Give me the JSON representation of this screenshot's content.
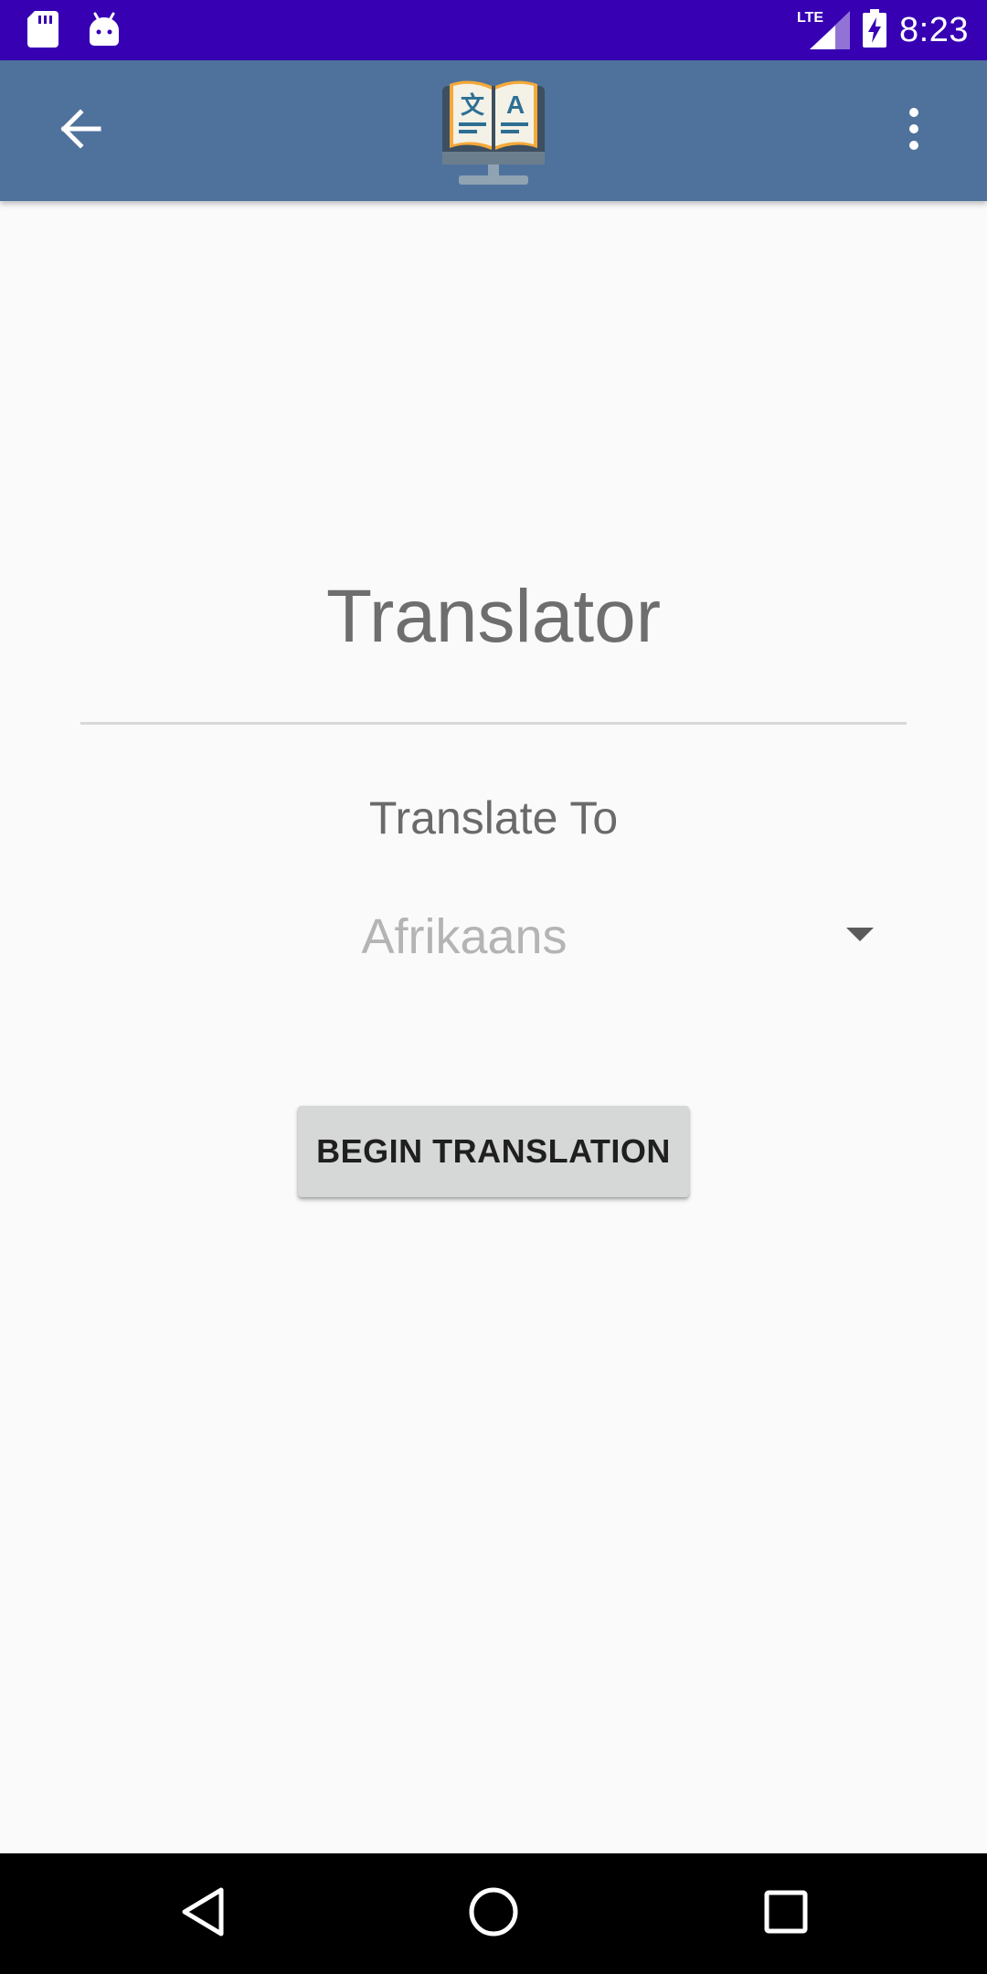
{
  "status_bar": {
    "time": "8:23",
    "network": "LTE",
    "icons": [
      "sd-card-icon",
      "android-icon",
      "signal-icon",
      "battery-charging-icon"
    ]
  },
  "app_bar": {
    "back_icon": "arrow-back-icon",
    "logo_icon": "translator-book-monitor-icon",
    "menu_icon": "more-vert-icon",
    "background_color": "#4f729c"
  },
  "main": {
    "title": "Translator",
    "subtitle": "Translate To",
    "language_select": {
      "selected": "Afrikaans"
    },
    "action_button_label": "BEGIN TRANSLATION"
  },
  "nav_bar": {
    "icons": [
      "nav-back-icon",
      "nav-home-icon",
      "nav-recents-icon"
    ]
  },
  "colors": {
    "status_bar": "#3700b3",
    "app_bar": "#4f729c",
    "background": "#fafafa",
    "button": "#d6d7d7"
  }
}
